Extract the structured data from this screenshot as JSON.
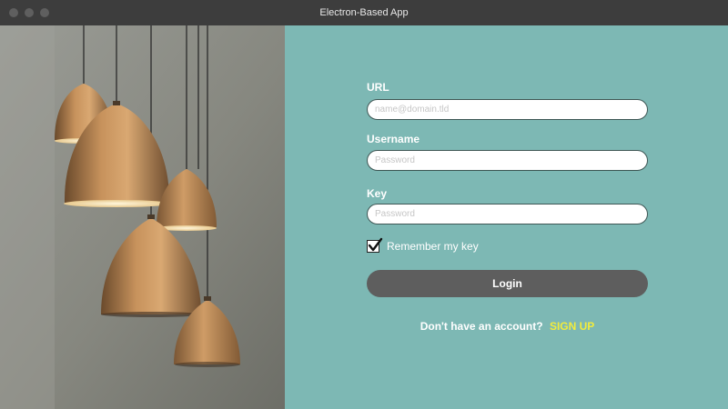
{
  "window": {
    "title": "Electron-Based App"
  },
  "hero": {
    "image": "pendant-lamps-photo"
  },
  "form": {
    "url": {
      "label": "URL",
      "placeholder": "name@domain.tld",
      "value": ""
    },
    "username": {
      "label": "Username",
      "placeholder": "Password",
      "value": ""
    },
    "key": {
      "label": "Key",
      "placeholder": "Password",
      "value": ""
    },
    "remember": {
      "label": "Remember my key",
      "checked": true
    },
    "login_label": "Login",
    "signup_prompt": "Don't have an account?",
    "signup_link": "SIGN UP"
  },
  "colors": {
    "panel_background": "#7db8b4",
    "titlebar": "#3d3d3d",
    "login_button": "#5e5e5e",
    "signup_link": "#f2ec3c"
  },
  "icons": [
    "checkmark-icon",
    "close-dot-icon",
    "minimize-dot-icon",
    "maximize-dot-icon"
  ]
}
